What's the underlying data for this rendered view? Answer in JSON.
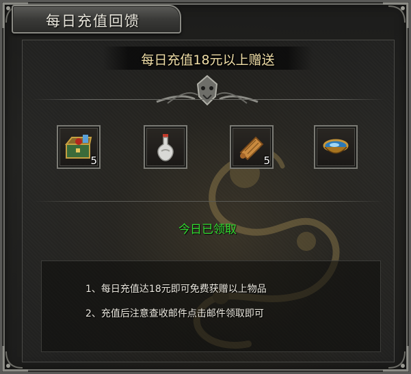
{
  "window": {
    "title": "每日充值回馈"
  },
  "header": {
    "text": "每日充值18元以上赠送"
  },
  "rewards": [
    {
      "icon": "treasure-chest-icon",
      "count": "5"
    },
    {
      "icon": "potion-vase-icon",
      "count": ""
    },
    {
      "icon": "scroll-icon",
      "count": "5"
    },
    {
      "icon": "jade-bowl-icon",
      "count": ""
    }
  ],
  "status": {
    "text": "今日已领取",
    "color": "#2fd92f"
  },
  "description": {
    "lines": [
      "1、每日充值达18元即可免费获赠以上物品",
      "2、充值后注意查收邮件点击邮件领取即可"
    ]
  },
  "colors": {
    "header_text": "#f1dfa8",
    "frame": "#7a7a74"
  }
}
